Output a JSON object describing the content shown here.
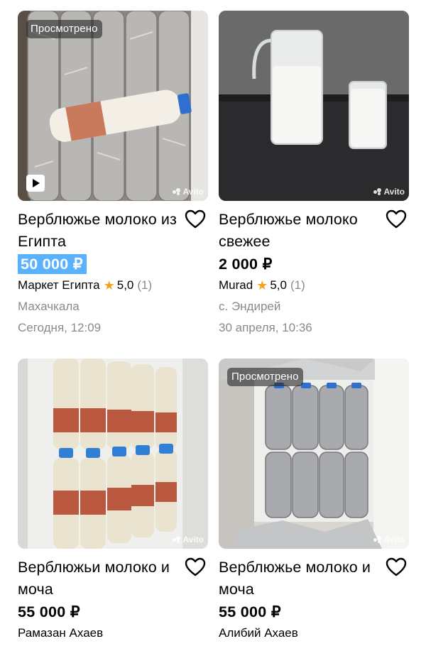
{
  "listings": [
    {
      "viewed_badge": "Просмотрено",
      "has_video": true,
      "watermark": "Avito",
      "title": "Верблюжье молоко из Египта",
      "price": "50 000 ₽",
      "price_highlighted": true,
      "seller": "Маркет Египта",
      "rating": "5,0",
      "rating_count": "(1)",
      "location": "Махачкала",
      "date": "Сегодня, 12:09"
    },
    {
      "viewed_badge": "",
      "has_video": false,
      "watermark": "Avito",
      "title": "Верблюжье молоко свежее",
      "price": "2 000 ₽",
      "price_highlighted": false,
      "seller": "Murad",
      "rating": "5,0",
      "rating_count": "(1)",
      "location": "с. Эндирей",
      "date": "30 апреля, 10:36"
    },
    {
      "viewed_badge": "",
      "has_video": false,
      "watermark": "Avito",
      "title": "Верблюжьи молоко и моча",
      "price": "55 000 ₽",
      "price_highlighted": false,
      "seller": "Рамазан Ахаев"
    },
    {
      "viewed_badge": "Просмотрено",
      "has_video": false,
      "watermark": "Avito",
      "title": "Верблюжье молоко и моча",
      "price": "55 000 ₽",
      "price_highlighted": false,
      "seller": "Алибий Ахаев"
    }
  ],
  "colors": {
    "price_highlight": "#5ab2ff",
    "star": "#f7a21b",
    "secondary_text": "#8a8a8a"
  },
  "icons": {
    "favorite": "heart-outline-icon",
    "rating": "star-icon",
    "video": "play-icon"
  }
}
